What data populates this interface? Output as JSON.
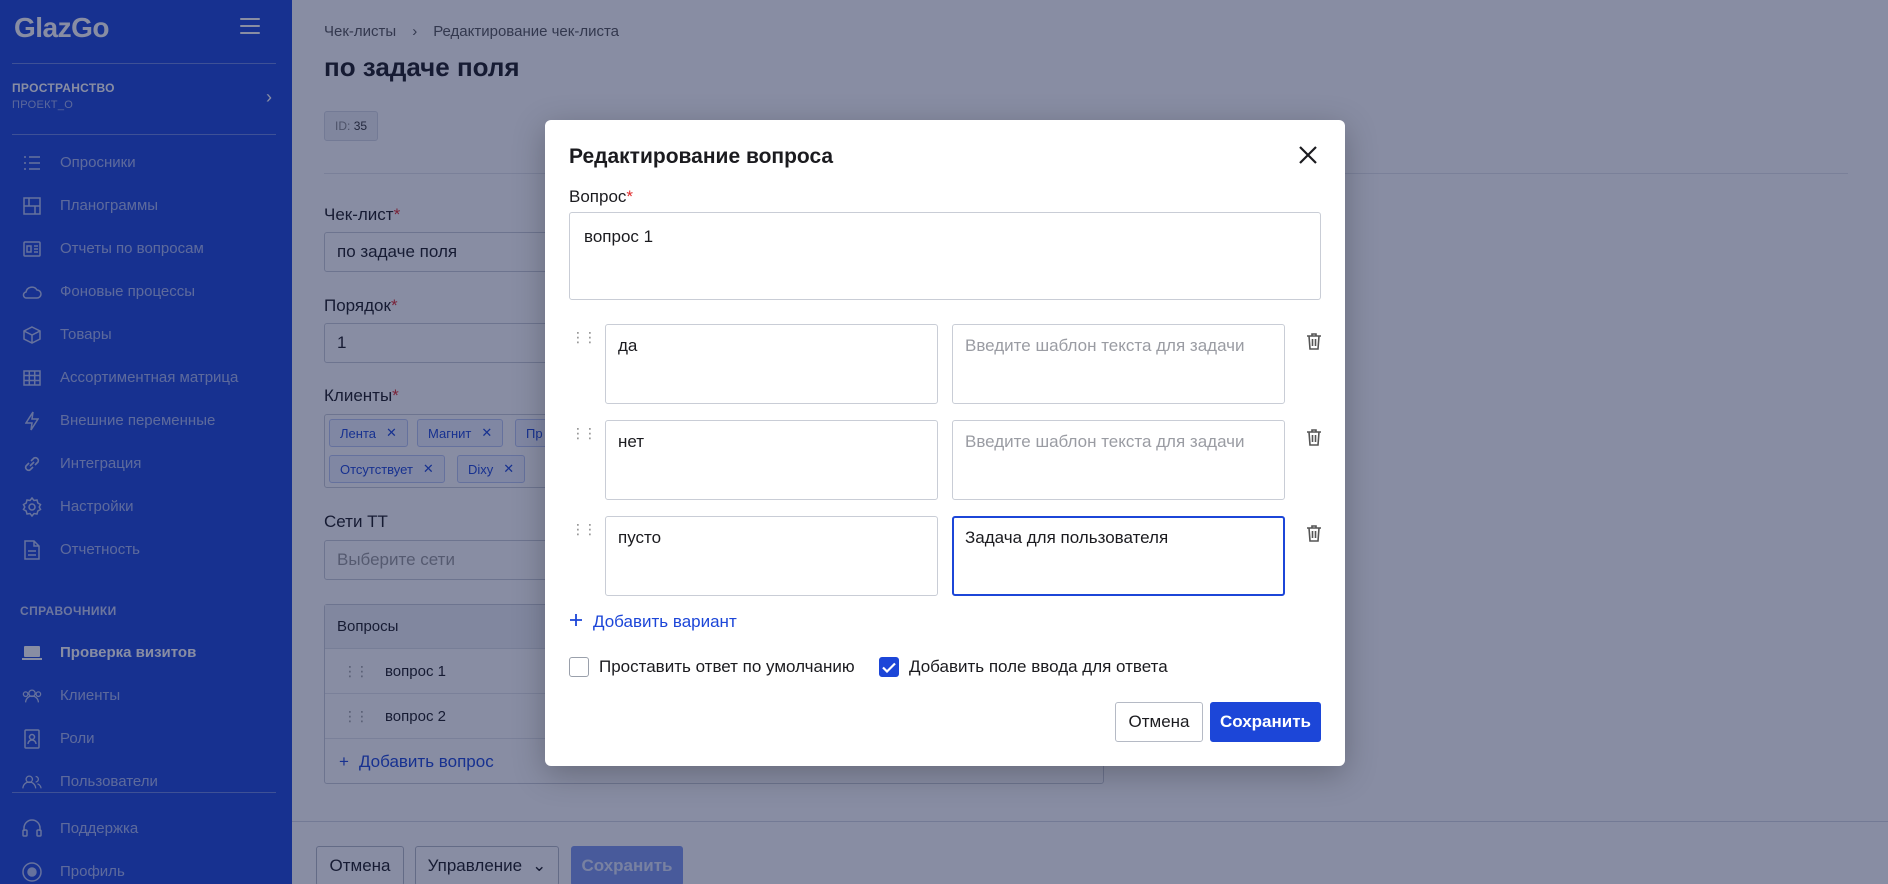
{
  "app": {
    "logo": "GlazGo"
  },
  "sidebar": {
    "space_title": "ПРОСТРАНСТВО",
    "space_project": "ПРОЕКТ_О",
    "items": [
      {
        "label": "Опросники",
        "icon": "list-icon"
      },
      {
        "label": "Планограммы",
        "icon": "planogram-icon"
      },
      {
        "label": "Отчеты по вопросам",
        "icon": "report-icon"
      },
      {
        "label": "Фоновые процессы",
        "icon": "cloud-icon"
      },
      {
        "label": "Товары",
        "icon": "box-icon"
      },
      {
        "label": "Ассортиментная матрица",
        "icon": "grid-icon"
      },
      {
        "label": "Внешние переменные",
        "icon": "bolt-icon"
      },
      {
        "label": "Интеграция",
        "icon": "link-icon"
      },
      {
        "label": "Настройки",
        "icon": "gear-icon"
      },
      {
        "label": "Отчетность",
        "icon": "document-icon"
      }
    ],
    "section_label": "СПРАВОЧНИКИ",
    "ref_items": [
      {
        "label": "Проверка визитов",
        "icon": "laptop-icon"
      },
      {
        "label": "Клиенты",
        "icon": "users-icon"
      },
      {
        "label": "Роли",
        "icon": "badge-icon"
      },
      {
        "label": "Пользователи",
        "icon": "user-group-icon"
      }
    ],
    "bottom_items": [
      {
        "label": "Поддержка",
        "icon": "headset-icon"
      },
      {
        "label": "Профиль",
        "icon": "profile-icon"
      }
    ]
  },
  "page": {
    "breadcrumb": [
      "Чек-листы",
      "Редактирование чек-листа"
    ],
    "title": "по задаче поля",
    "id_label": "ID:",
    "id_value": "35",
    "checklist_label": "Чек-лист",
    "checklist_value": "по задаче поля",
    "order_label": "Порядок",
    "order_value": "1",
    "clients_label": "Клиенты",
    "clients": [
      "Лента",
      "Магнит",
      "Пр",
      "Отсутствует",
      "Dixy"
    ],
    "networks_label": "Сети ТТ",
    "networks_placeholder": "Выберите сети",
    "questions_header": "Вопросы",
    "questions": [
      "вопрос 1",
      "вопрос 2"
    ],
    "add_question": "Добавить вопрос",
    "footer": {
      "cancel": "Отмена",
      "manage": "Управление",
      "save": "Сохранить"
    }
  },
  "modal": {
    "title": "Редактирование вопроса",
    "question_label": "Вопрос",
    "question_value": "вопрос 1",
    "task_placeholder": "Введите шаблон текста для задачи",
    "variants": [
      {
        "answer": "да",
        "task": ""
      },
      {
        "answer": "нет",
        "task": ""
      },
      {
        "answer": "пусто",
        "task": "Задача для пользователя"
      }
    ],
    "add_variant": "Добавить вариант",
    "default_answer_label": "Проставить ответ по умолчанию",
    "default_answer_checked": false,
    "input_field_label": "Добавить поле ввода для ответа",
    "input_field_checked": true,
    "cancel": "Отмена",
    "save": "Сохранить"
  },
  "colors": {
    "accent": "#1c46d8",
    "required": "#e02a2a"
  }
}
